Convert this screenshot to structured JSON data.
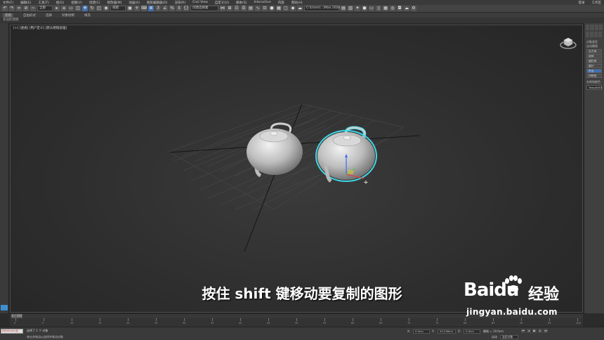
{
  "menubar": {
    "items": [
      "文件(F)",
      "编辑(E)",
      "工具(T)",
      "组(G)",
      "视图(V)",
      "创建(C)",
      "修改器(M)",
      "动画(A)",
      "图形编辑器(D)",
      "渲染(R)",
      "Civil View",
      "自定义(U)",
      "脚本(S)",
      "Interactive",
      "内容",
      "帮助(H)"
    ],
    "sign_in": "登录",
    "workspace": "工作区"
  },
  "toolbar": {
    "filter_value": "全部",
    "view_value": "视图",
    "selection_set_placeholder": "创建选择集",
    "project_path": "C:\\Users\\...\\Max 2020"
  },
  "ribbon": {
    "tabs": [
      "建模",
      "自由形式",
      "选择",
      "对象绘制",
      "填充"
    ],
    "active_tab": "建模",
    "sub_label": "多边形建模"
  },
  "viewport": {
    "label": "[+] [透视] [用户定义] [默认明暗处理]"
  },
  "command_panel": {
    "section_object_type": "对象类型",
    "auto_grid": "自动栅格",
    "buttons": [
      "长方体",
      "球体",
      "圆柱体",
      "圆环",
      "茶壶",
      "四棱锥"
    ],
    "section_name_color": "名称和颜色",
    "object_name": "Teapot001"
  },
  "time": {
    "slider_label": "0 / 100",
    "ticks": [
      0,
      5,
      10,
      15,
      20,
      25,
      30,
      35,
      40,
      45,
      50,
      55,
      60,
      65,
      70,
      75,
      80,
      85,
      90,
      95,
      100
    ]
  },
  "status": {
    "script_label": "MAXScript 迷",
    "selection_text": "选择了 1 个 对象",
    "hint_text": "单击并拖动以选择并移动对象",
    "x_value": "0.0cm",
    "y_value": "43.206cm",
    "z_value": "0.0cm",
    "grid_value": "栅格 = 10.0cm",
    "autokey_label": "自动",
    "selected_label": "选定对象"
  },
  "overlay": {
    "subtitle": "按住 shift 键移动要复制的图形",
    "watermark_brand": "Baidu",
    "watermark_product": "经验",
    "watermark_url": "jingyan.baidu.com"
  },
  "colors": {
    "selection_outline": "#3fd8e8",
    "grid_line": "#5a5a5a",
    "accent": "#3f6fb0"
  }
}
